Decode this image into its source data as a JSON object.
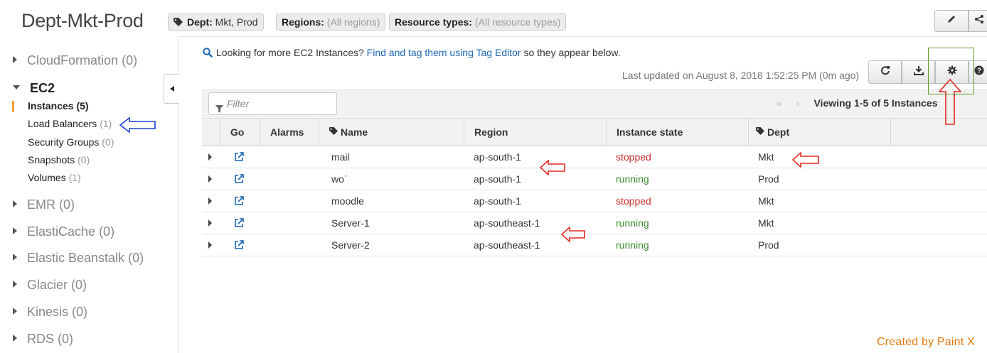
{
  "header": {
    "title": "Dept-Mkt-Prod",
    "badges": [
      {
        "label": "Dept:",
        "value": "Mkt, Prod"
      },
      {
        "label": "Regions:",
        "value": "(All regions)"
      },
      {
        "label": "Resource types:",
        "value": "(All resource types)"
      }
    ]
  },
  "sidebar": {
    "services": [
      {
        "name": "CloudFormation",
        "count": "(0)"
      },
      {
        "name": "EC2",
        "count": ""
      },
      {
        "name": "EMR",
        "count": "(0)"
      },
      {
        "name": "ElastiCache",
        "count": "(0)"
      },
      {
        "name": "Elastic Beanstalk",
        "count": "(0)"
      },
      {
        "name": "Glacier",
        "count": "(0)"
      },
      {
        "name": "Kinesis",
        "count": "(0)"
      },
      {
        "name": "RDS",
        "count": "(0)"
      }
    ],
    "ec2_items": [
      {
        "label": "Instances",
        "count": "(5)"
      },
      {
        "label": "Load Balancers",
        "count": "(1)"
      },
      {
        "label": "Security Groups",
        "count": "(0)"
      },
      {
        "label": "Snapshots",
        "count": "(0)"
      },
      {
        "label": "Volumes",
        "count": "(1)"
      }
    ]
  },
  "main": {
    "info_prefix": "Looking for more EC2 Instances?",
    "info_link": "Find and tag them using Tag Editor",
    "info_suffix": "so they appear below.",
    "last_updated": "Last updated on August 8, 2018 1:52:25 PM (0m ago)",
    "filter_placeholder": "Filter",
    "pager_first": "«",
    "pager_prev": "‹",
    "viewing": "Viewing 1-5 of 5 Instances",
    "columns": [
      "Go",
      "Alarms",
      "Name",
      "Region",
      "Instance state",
      "Dept"
    ],
    "rows": [
      {
        "name": "mail",
        "region": "ap-south-1",
        "state": "stopped",
        "dept": "Mkt"
      },
      {
        "name": "woʿ",
        "region": "ap-south-1",
        "state": "running",
        "dept": "Prod"
      },
      {
        "name": "moodle",
        "region": "ap-south-1",
        "state": "stopped",
        "dept": "Mkt"
      },
      {
        "name": "Server-1",
        "region": "ap-southeast-1",
        "state": "running",
        "dept": "Mkt"
      },
      {
        "name": "Server-2",
        "region": "ap-southeast-1",
        "state": "running",
        "dept": "Prod"
      }
    ]
  },
  "toolbar_icons": [
    "refresh-icon",
    "download-icon",
    "gear-icon",
    "help-icon"
  ],
  "colors": {
    "stopped": "#c72b28",
    "running": "#3b8a2e",
    "link": "#1c67b3",
    "active_marker": "#f0a038"
  },
  "credit": "Created by Paint X"
}
